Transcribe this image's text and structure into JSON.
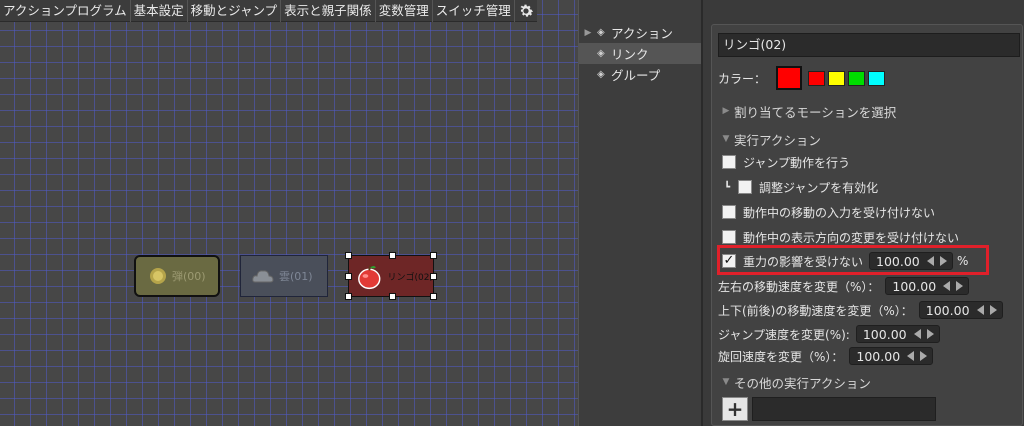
{
  "menubar": {
    "items": [
      "アクションプログラム",
      "基本設定",
      "移動とジャンプ",
      "表示と親子関係",
      "変数管理",
      "スイッチ管理"
    ],
    "settings_icon": "gear-icon"
  },
  "canvas": {
    "nodes": [
      {
        "label": "弾(00)",
        "icon": "bullet-icon"
      },
      {
        "label": "雲(01)",
        "icon": "cloud-icon"
      },
      {
        "label": "リンゴ(02)",
        "icon": "apple-icon"
      }
    ]
  },
  "tree": {
    "items": [
      {
        "label": "アクション",
        "expanded": false
      },
      {
        "label": "リンク",
        "selected": true
      },
      {
        "label": "グループ"
      }
    ]
  },
  "props": {
    "name": "リンゴ(02)",
    "color_label": "カラー：",
    "colors": {
      "selected": "#ff0000",
      "options": [
        "#ff0000",
        "#ffff00",
        "#00dd00",
        "#00ffff"
      ]
    },
    "motion_section": "割り当てるモーションを選択",
    "exec_section": "実行アクション",
    "checkboxes": [
      {
        "label": "ジャンプ動作を行う",
        "checked": false
      },
      {
        "label": "調整ジャンプを有効化",
        "checked": false,
        "prefix": "┗"
      },
      {
        "label": "動作中の移動の入力を受け付けない",
        "checked": false
      },
      {
        "label": "動作中の表示方向の変更を受け付けない",
        "checked": false
      },
      {
        "label": "重力の影響を受けない",
        "checked": true,
        "value": "100.00",
        "unit": "%"
      }
    ],
    "speed_rows": [
      {
        "label": "左右の移動速度を変更（%）：",
        "value": "100.00"
      },
      {
        "label": "上下(前後)の移動速度を変更（%）：",
        "value": "100.00"
      },
      {
        "label": "ジャンプ速度を変更(%):",
        "value": "100.00"
      },
      {
        "label": "旋回速度を変更（%）：",
        "value": "100.00"
      }
    ],
    "other_section": "その他の実行アクション",
    "add_label": "+"
  }
}
